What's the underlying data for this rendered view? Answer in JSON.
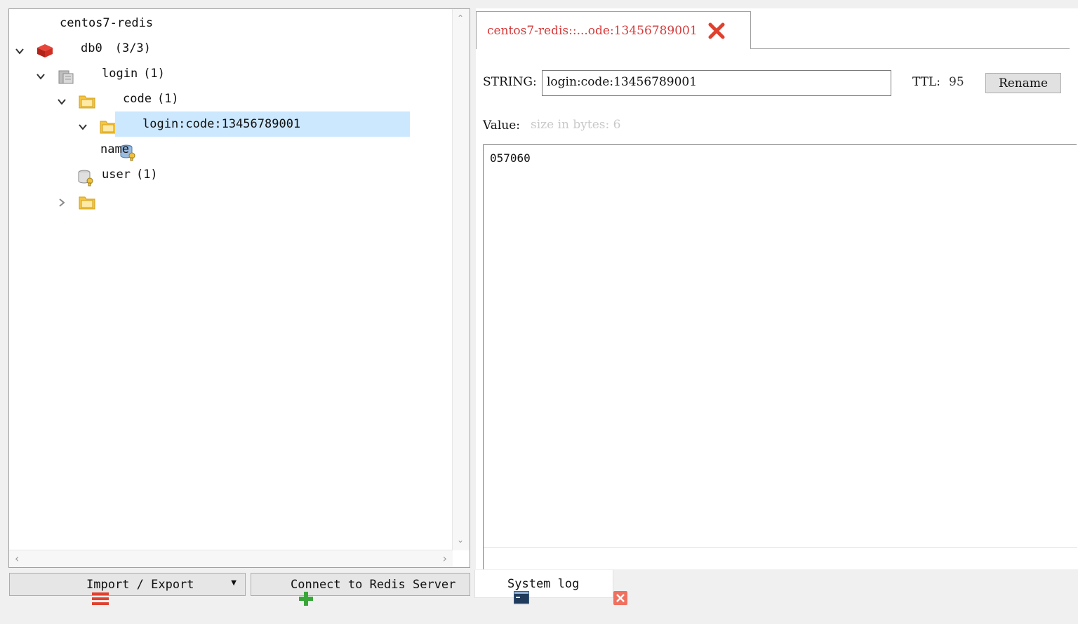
{
  "tree": {
    "connection": {
      "label": "centos7-redis"
    },
    "database": {
      "label": "db0",
      "count": "(3/3)"
    },
    "folders": [
      {
        "name": "login",
        "count": "(1)"
      },
      {
        "name": "code",
        "count": "(1)"
      },
      {
        "name": "user",
        "count": "(1)"
      }
    ],
    "keys": [
      {
        "name": "login:code:13456789001"
      },
      {
        "name": "name"
      }
    ]
  },
  "editor": {
    "tab_label": "centos7-redis::...ode:13456789001",
    "type_label": "STRING:",
    "key_name": "login:code:13456789001",
    "ttl_label": "TTL:",
    "ttl_value": "95",
    "rename_label": "Rename",
    "value_label": "Value:",
    "size_hint": "size in bytes: 6",
    "value": "057060"
  },
  "bottom": {
    "import_export_label": "Import / Export",
    "connect_label": "Connect to Redis Server",
    "system_log_label": "System log"
  },
  "icons": {
    "redis": "redis-server-icon",
    "db": "database-icon",
    "folder": "folder-icon",
    "key": "key-icon",
    "close": "close-icon",
    "menu": "menu-icon",
    "plus": "plus-icon",
    "console": "console-icon"
  },
  "colors": {
    "selection": "#cce8ff",
    "tab_text": "#d43a3a",
    "close_red": "#e0402e",
    "folder_yellow": "#f5c542",
    "plus_green": "#3aa63a"
  }
}
